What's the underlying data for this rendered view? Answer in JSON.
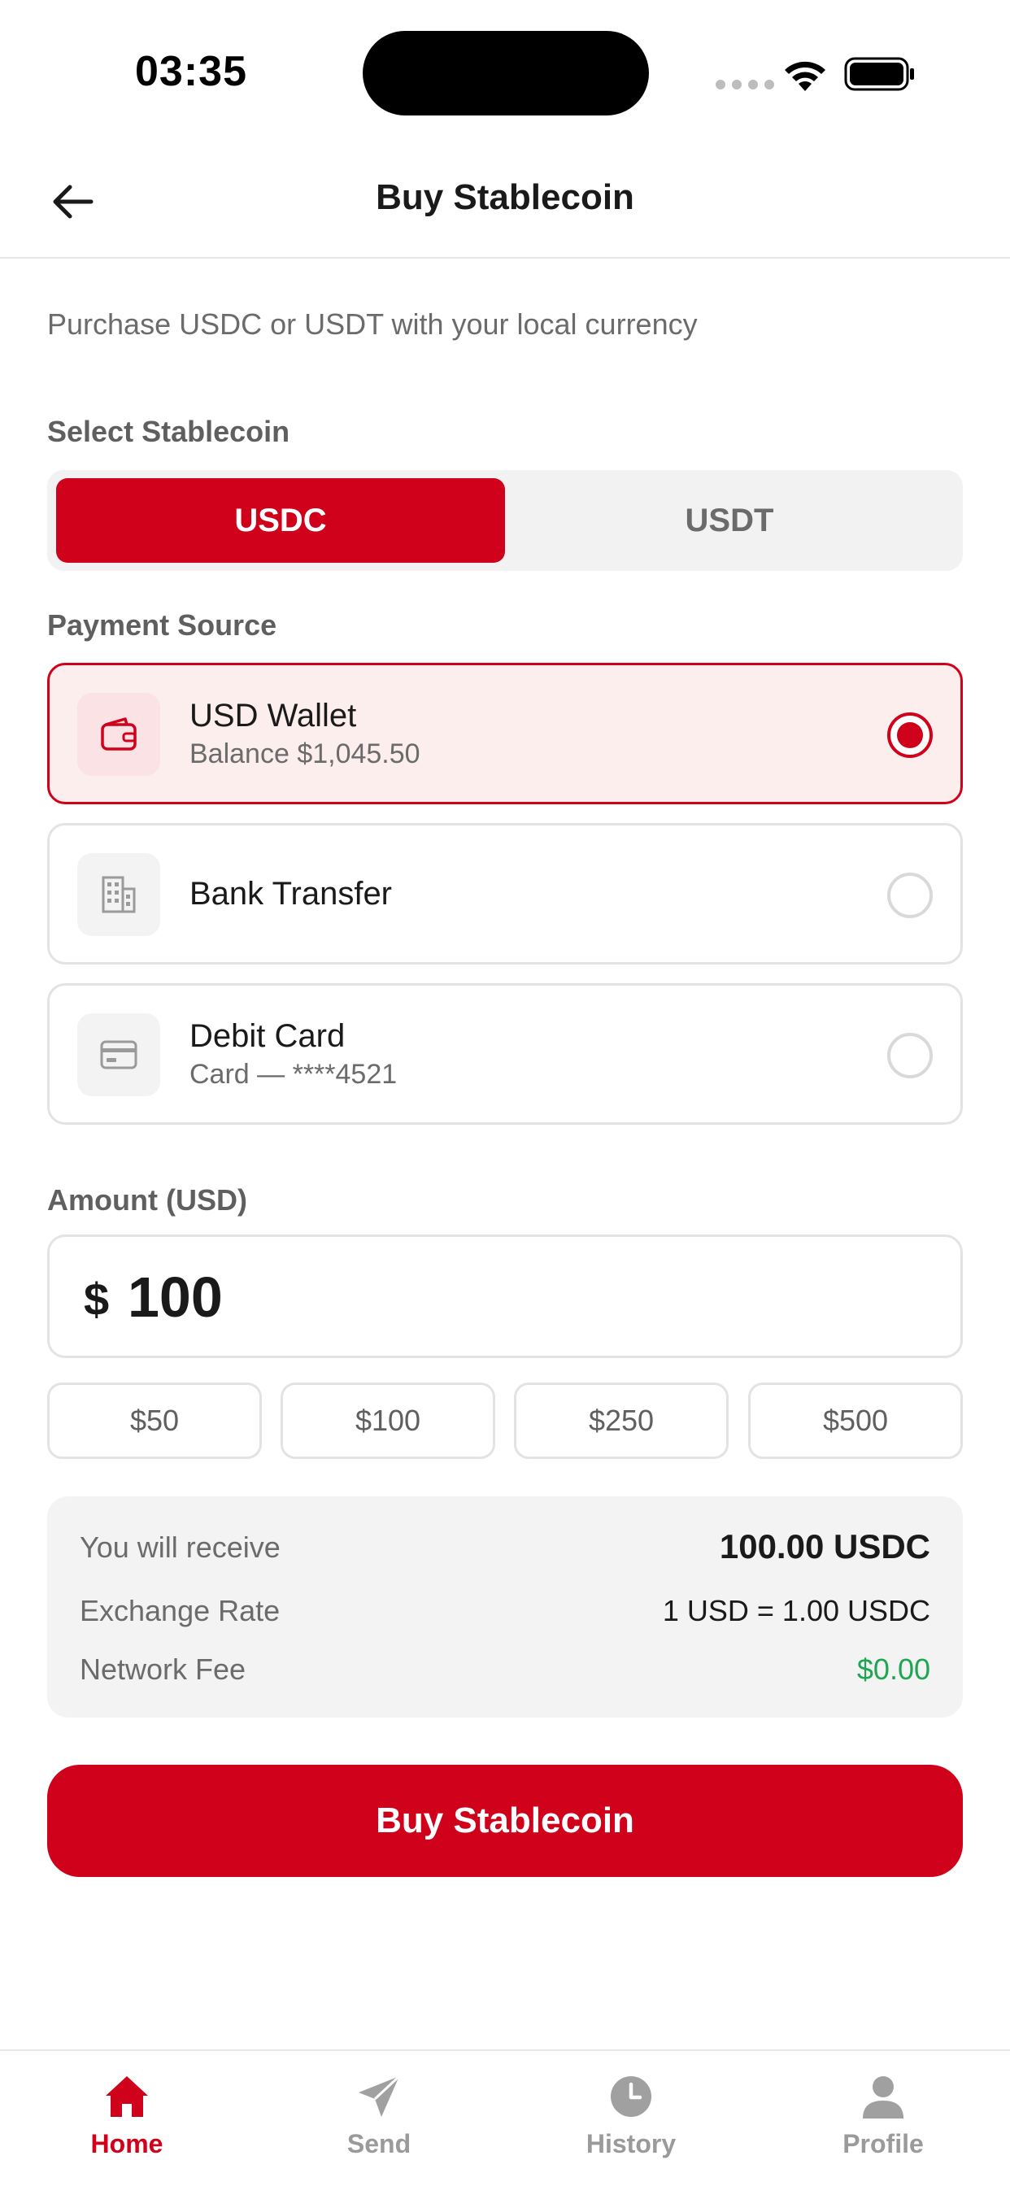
{
  "status_bar": {
    "time": "03:35"
  },
  "header": {
    "title": "Buy Stablecoin"
  },
  "subtitle": "Purchase USDC or USDT with your local currency",
  "stablecoin": {
    "label": "Select Stablecoin",
    "options": [
      {
        "label": "USDC",
        "selected": true
      },
      {
        "label": "USDT",
        "selected": false
      }
    ]
  },
  "payment": {
    "label": "Payment Source",
    "sources": [
      {
        "title": "USD Wallet",
        "subtitle": "Balance $1,045.50",
        "icon": "wallet-icon",
        "selected": true
      },
      {
        "title": "Bank Transfer",
        "subtitle": "",
        "icon": "building-icon",
        "selected": false
      },
      {
        "title": "Debit Card",
        "subtitle": "Card — ****4521",
        "icon": "card-icon",
        "selected": false
      }
    ]
  },
  "amount": {
    "label": "Amount (USD)",
    "currency_symbol": "$",
    "value": "100",
    "quick_amounts": [
      "$50",
      "$100",
      "$250",
      "$500"
    ]
  },
  "summary": {
    "receive_label": "You will receive",
    "receive_value": "100.00 USDC",
    "rate_label": "Exchange Rate",
    "rate_value": "1 USD = 1.00 USDC",
    "fee_label": "Network Fee",
    "fee_value": "$0.00"
  },
  "buy_button": "Buy Stablecoin",
  "nav": [
    {
      "label": "Home",
      "icon": "home-icon",
      "active": true
    },
    {
      "label": "Send",
      "icon": "send-icon",
      "active": false
    },
    {
      "label": "History",
      "icon": "clock-icon",
      "active": false
    },
    {
      "label": "Profile",
      "icon": "profile-icon",
      "active": false
    }
  ],
  "colors": {
    "accent": "#d0011b",
    "selected_bg": "#fdeeee",
    "fee_green": "#1fa655"
  }
}
